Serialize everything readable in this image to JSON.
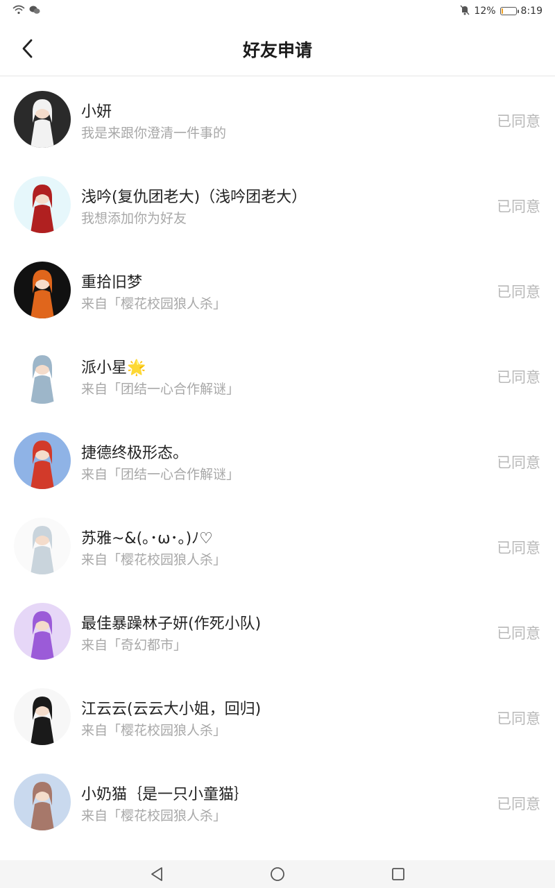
{
  "status_bar": {
    "battery_text": "12%",
    "battery_level": 0.12,
    "time": "8:19"
  },
  "header": {
    "title": "好友申请"
  },
  "requests": [
    {
      "name": "小妍",
      "subtitle": "我是来跟你澄清一件事的",
      "status": "已同意",
      "avatar_bg": "#2a2a2a",
      "avatar_fg": "#f2f2f2"
    },
    {
      "name": "浅吟(复仇团老大)（浅吟团老大）",
      "subtitle": "我想添加你为好友",
      "status": "已同意",
      "avatar_bg": "#e6f7fb",
      "avatar_fg": "#b02020"
    },
    {
      "name": "重拾旧梦",
      "subtitle": "来自「樱花校园狼人杀」",
      "status": "已同意",
      "avatar_bg": "#111111",
      "avatar_fg": "#e0661c"
    },
    {
      "name": "派小星🌟",
      "subtitle": "来自「团结一心合作解谜」",
      "status": "已同意",
      "avatar_bg": "#ffffff",
      "avatar_fg": "#9db6c9"
    },
    {
      "name": "捷德终极形态。",
      "subtitle": "来自「团结一心合作解谜」",
      "status": "已同意",
      "avatar_bg": "#8fb3e6",
      "avatar_fg": "#d23a2a"
    },
    {
      "name": "苏雅~&(｡･ω･｡)ﾉ♡",
      "subtitle": "来自「樱花校园狼人杀」",
      "status": "已同意",
      "avatar_bg": "#fafafa",
      "avatar_fg": "#c9d4dc"
    },
    {
      "name": "最佳暴躁林子妍(作死小队)",
      "subtitle": "来自「奇幻都市」",
      "status": "已同意",
      "avatar_bg": "#e6d7f7",
      "avatar_fg": "#9b5bd8"
    },
    {
      "name": "江云云(云云大小姐，回归)",
      "subtitle": "来自「樱花校园狼人杀」",
      "status": "已同意",
      "avatar_bg": "#f7f7f7",
      "avatar_fg": "#1a1a1a"
    },
    {
      "name": "小奶猫｛是一只小童猫｝",
      "subtitle": "来自「樱花校园狼人杀」",
      "status": "已同意",
      "avatar_bg": "#c9d9ee",
      "avatar_fg": "#a7786a"
    }
  ]
}
